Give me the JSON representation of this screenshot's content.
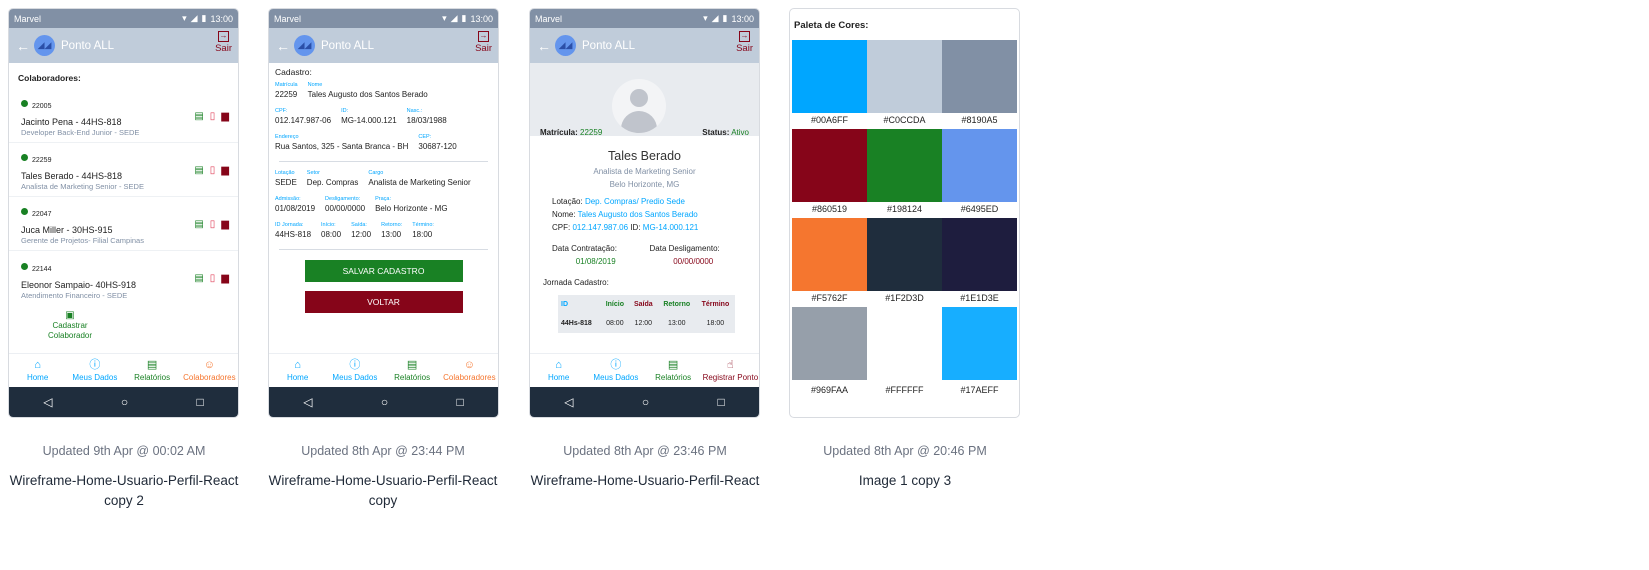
{
  "phone": {
    "carrier": "Marvel",
    "time": "13:00",
    "app_title": "Ponto ALL",
    "logout_label": "Sair",
    "nav_home": "Home",
    "nav_dados": "Meus Dados",
    "nav_relatorios": "Relatórios",
    "nav_colaboradores": "Colaboradores",
    "nav_registrar": "Registrar Ponto"
  },
  "cards": [
    {
      "updated": "Updated 9th Apr @ 00:02 AM",
      "title": "Wireframe-Home-Usuario-Perfil-React copy 2"
    },
    {
      "updated": "Updated 8th Apr @ 23:44 PM",
      "title": "Wireframe-Home-Usuario-Perfil-React copy"
    },
    {
      "updated": "Updated 8th Apr @ 23:46 PM",
      "title": "Wireframe-Home-Usuario-Perfil-React"
    },
    {
      "updated": "Updated 8th Apr @ 20:46 PM",
      "title": "Image 1 copy 3"
    }
  ],
  "screen1": {
    "heading": "Colaboradores:",
    "rows": [
      {
        "code": "22005",
        "name": "Jacinto Pena - 44HS-818",
        "role": "Developer Back-End Junior - SEDE"
      },
      {
        "code": "22259",
        "name": "Tales Berado - 44HS-818",
        "role": "Analista de Marketing Senior - SEDE"
      },
      {
        "code": "22047",
        "name": "Juca Miller - 30HS-915",
        "role": "Gerente de Projetos- Filial Campinas"
      },
      {
        "code": "22144",
        "name": "Eleonor Sampaio- 40HS-918",
        "role": "Atendimento Financeiro - SEDE"
      }
    ],
    "add_label_1": "Cadastrar",
    "add_label_2": "Colaborador"
  },
  "screen2": {
    "heading": "Cadastro:",
    "lbl_matricula": "Matrícula",
    "val_matricula": "22259",
    "lbl_nome": "Nome",
    "val_nome": "Tales Augusto dos Santos Berado",
    "lbl_cpf": "CPF:",
    "val_cpf": "012.147.987-06",
    "lbl_id": "ID:",
    "val_id": "MG-14.000.121",
    "lbl_nasc": "Nasc.:",
    "val_nasc": "18/03/1988",
    "lbl_endereco": "Endereço",
    "val_endereco": "Rua Santos, 325 - Santa Branca - BH",
    "lbl_cep": "CEP:",
    "val_cep": "30687-120",
    "lbl_lotacao": "Lotação",
    "val_lotacao": "SEDE",
    "lbl_setor": "Setor",
    "val_setor": "Dep. Compras",
    "lbl_cargo": "Cargo",
    "val_cargo": "Analista de Marketing Senior",
    "lbl_admissao": "Admissão:",
    "val_admissao": "01/08/2019",
    "lbl_deslig": "Desligamento:",
    "val_deslig": "00/00/0000",
    "lbl_praca": "Praça:",
    "val_praca": "Belo Horizonte - MG",
    "lbl_jornada": "ID Jornada:",
    "val_jornada": "44HS-818",
    "lbl_inicio": "Início:",
    "val_inicio": "08:00",
    "lbl_saida": "Saída:",
    "val_saida": "12:00",
    "lbl_retorno": "Retorno:",
    "val_retorno": "13:00",
    "lbl_termino": "Término:",
    "val_termino": "18:00",
    "btn_save": "SALVAR CADASTRO",
    "btn_back": "VOLTAR"
  },
  "screen3": {
    "lbl_matricula": "Matrícula:",
    "val_matricula": "22259",
    "lbl_status": "Status:",
    "val_status": "Ativo",
    "name": "Tales Berado",
    "role": "Analista de Marketing Senior",
    "city": "Belo Horizonte, MG",
    "lbl_lotacao": "Lotação:",
    "val_lotacao": "Dep. Compras/ Predio Sede",
    "lbl_nome": "Nome:",
    "val_nome": "Tales Augusto dos Santos Berado",
    "lbl_cpf": "CPF:",
    "val_cpf": "012.147.987.06",
    "lbl_id": "ID:",
    "val_id": "MG-14.000.121",
    "lbl_contratacao": "Data Contratação:",
    "val_contratacao": "01/08/2019",
    "lbl_deslig": "Data Desligamento:",
    "val_deslig": "00/00/0000",
    "jornada_heading": "Jornada Cadastro:",
    "th_id": "ID",
    "th_inicio": "Início",
    "th_saida": "Saída",
    "th_retorno": "Retorno",
    "th_termino": "Término",
    "td_id": "44Hs-818",
    "td_inicio": "08:00",
    "td_saida": "12:00",
    "td_retorno": "13:00",
    "td_termino": "18:00"
  },
  "palette": {
    "heading": "Paleta de Cores:",
    "colors": [
      {
        "hex": "#00A6FF",
        "label": "#00A6FF"
      },
      {
        "hex": "#C0CCDA",
        "label": "#C0CCDA"
      },
      {
        "hex": "#8190A5",
        "label": "#8190A5"
      },
      {
        "hex": "#860519",
        "label": "#860519"
      },
      {
        "hex": "#198124",
        "label": "#198124"
      },
      {
        "hex": "#6495ED",
        "label": "#6495ED"
      },
      {
        "hex": "#F5762F",
        "label": "#F5762F"
      },
      {
        "hex": "#1F2D3D",
        "label": "#1F2D3D"
      },
      {
        "hex": "#1E1D3E",
        "label": "#1E1D3E"
      },
      {
        "hex": "#969FAA",
        "label": "#969FAA"
      },
      {
        "hex": "#FFFFFF",
        "label": "#FFFFFF"
      },
      {
        "hex": "#17AEFF",
        "label": "#17AEFF"
      }
    ]
  },
  "colors": {
    "green": "#198124",
    "red": "#860519",
    "blue": "#00A6FF",
    "orange": "#F5762F",
    "gray": "#8190A5"
  }
}
